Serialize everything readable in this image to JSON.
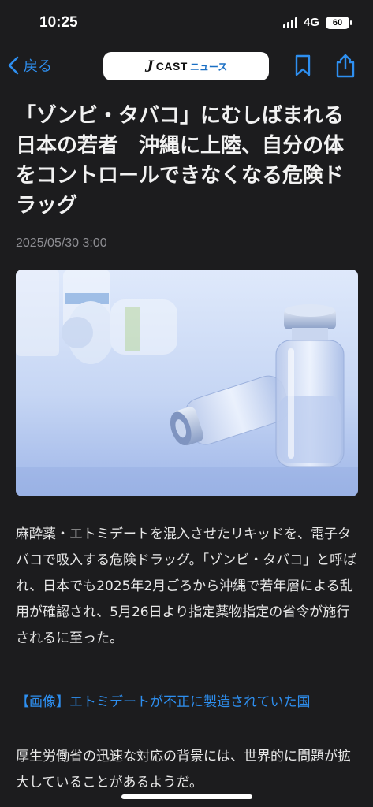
{
  "status": {
    "time": "10:25",
    "network": "4G",
    "battery": "60"
  },
  "nav": {
    "back_label": "戻る",
    "logo_j": "J",
    "logo_cast": "CAST",
    "logo_news": "ニュース"
  },
  "article": {
    "title": "「ゾンビ・タバコ」にむしばまれる日本の若者　沖縄に上陸、自分の体をコントロールできなくなる危険ドラッグ",
    "date": "2025/05/30 3:00",
    "paragraph1": "麻酔薬・エトミデートを混入させたリキッドを、電子タバコで吸入する危険ドラッグ。「ゾンビ・タバコ」と呼ばれ、日本でも2025年2月ごろから沖縄で若年層による乱用が確認され、5月26日より指定薬物指定の省令が施行されるに至った。",
    "image_link": "【画像】エトミデートが不正に製造されていた国",
    "paragraph2": "厚生労働省の迅速な対応の背景には、世界的に問題が拡大していることがあるようだ。"
  },
  "colors": {
    "accent": "#2e8ff0",
    "background": "#1c1c1e"
  }
}
